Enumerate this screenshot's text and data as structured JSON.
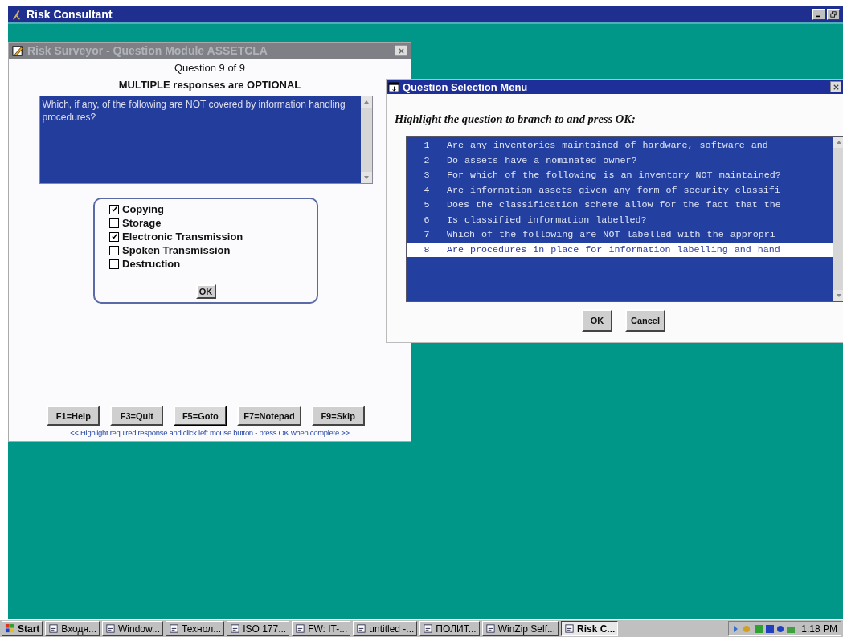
{
  "app": {
    "title": "Risk Consultant"
  },
  "question_window": {
    "title": "Risk Surveyor - Question Module ASSETCLA",
    "counter": "Question 9 of 9",
    "instruction": "MULTIPLE responses are OPTIONAL",
    "question": "Which, if any, of the following are NOT covered by information handling procedures?",
    "options": [
      {
        "label": "Copying",
        "checked": true
      },
      {
        "label": "Storage",
        "checked": false
      },
      {
        "label": "Electronic Transmission",
        "checked": true
      },
      {
        "label": "Spoken Transmission",
        "checked": false
      },
      {
        "label": "Destruction",
        "checked": false
      }
    ],
    "ok_button": "OK",
    "function_keys": [
      {
        "label": "F1=Help",
        "selected": false
      },
      {
        "label": "F3=Quit",
        "selected": false
      },
      {
        "label": "F5=Goto",
        "selected": true
      },
      {
        "label": "F7=Notepad",
        "selected": false
      },
      {
        "label": "F9=Skip",
        "selected": false
      }
    ],
    "hint": "<< Highlight required response and click left mouse button - press OK when complete >>"
  },
  "selection_menu": {
    "title": "Question Selection Menu",
    "prompt": "Highlight the question to branch to and press OK:",
    "questions": [
      {
        "number": "1",
        "text": "Are any inventories maintained of hardware, software and",
        "selected": false
      },
      {
        "number": "2",
        "text": "Do assets have a nominated owner?",
        "selected": false
      },
      {
        "number": "3",
        "text": "For which of the following is an inventory NOT maintained?",
        "selected": false
      },
      {
        "number": "4",
        "text": "Are information assets given any form of security classifi",
        "selected": false
      },
      {
        "number": "5",
        "text": "Does the classification scheme allow for the fact that the",
        "selected": false
      },
      {
        "number": "6",
        "text": "Is classified information labelled?",
        "selected": false
      },
      {
        "number": "7",
        "text": "Which of the following are NOT labelled with the appropri",
        "selected": false
      },
      {
        "number": "8",
        "text": "Are procedures in place for information labelling and hand",
        "selected": true
      }
    ],
    "buttons": [
      "OK",
      "Cancel"
    ]
  },
  "taskbar": {
    "start": "Start",
    "tasks": [
      {
        "label": "Входя...",
        "selected": false
      },
      {
        "label": "Window...",
        "selected": false
      },
      {
        "label": "Технол...",
        "selected": false
      },
      {
        "label": "ISO 177...",
        "selected": false
      },
      {
        "label": "FW: IT-...",
        "selected": false
      },
      {
        "label": "untitled -...",
        "selected": false
      },
      {
        "label": "ПОЛИТ...",
        "selected": false
      },
      {
        "label": "WinZip Self...",
        "selected": false
      },
      {
        "label": "Risk C...",
        "selected": true
      }
    ],
    "clock": "1:18 PM"
  }
}
